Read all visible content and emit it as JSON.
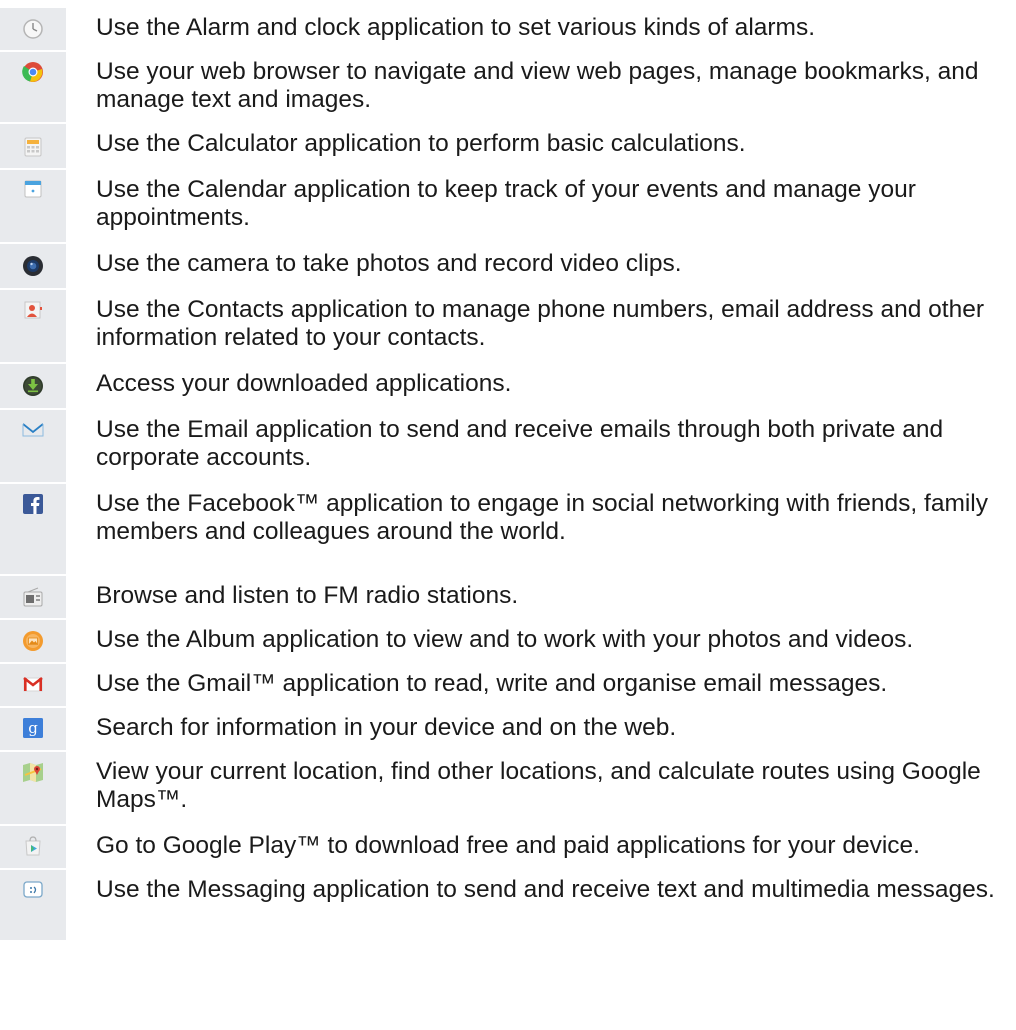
{
  "apps": [
    {
      "icon": "alarm-clock-icon",
      "description": "Use the Alarm and clock application to set various kinds of alarms."
    },
    {
      "icon": "web-browser-icon",
      "description": "Use your web browser to navigate and view web pages, manage bookmarks, and manage text and images."
    },
    {
      "icon": "calculator-icon",
      "description": "Use the Calculator application to perform basic calculations."
    },
    {
      "icon": "calendar-icon",
      "description": "Use the Calendar application to keep track of your events and manage your appointments."
    },
    {
      "icon": "camera-icon",
      "description": "Use the camera to take photos and record video clips."
    },
    {
      "icon": "contacts-icon",
      "description": "Use the Contacts application to manage phone numbers, email address and other information related to your contacts."
    },
    {
      "icon": "downloads-icon",
      "description": "Access your downloaded applications."
    },
    {
      "icon": "email-icon",
      "description": "Use the Email application to send and receive emails through both private and corporate accounts."
    },
    {
      "icon": "facebook-icon",
      "description": "Use the Facebook™ application to engage in social networking with friends, family members and colleagues around the world."
    },
    {
      "icon": "fm-radio-icon",
      "description": "Browse and listen to FM radio stations."
    },
    {
      "icon": "album-icon",
      "description": "Use the Album application to view and to work with your photos and videos."
    },
    {
      "icon": "gmail-icon",
      "description": "Use the Gmail™ application to read, write and organise email messages."
    },
    {
      "icon": "google-search-icon",
      "description": "Search for information in your device and on the web."
    },
    {
      "icon": "maps-icon",
      "description": "View your current location, find other locations, and calculate routes using Google Maps™."
    },
    {
      "icon": "play-store-icon",
      "description": "Go to Google Play™ to download free and paid applications for your device."
    },
    {
      "icon": "messaging-icon",
      "description": "Use the Messaging application to send and receive text and multimedia messages."
    }
  ]
}
